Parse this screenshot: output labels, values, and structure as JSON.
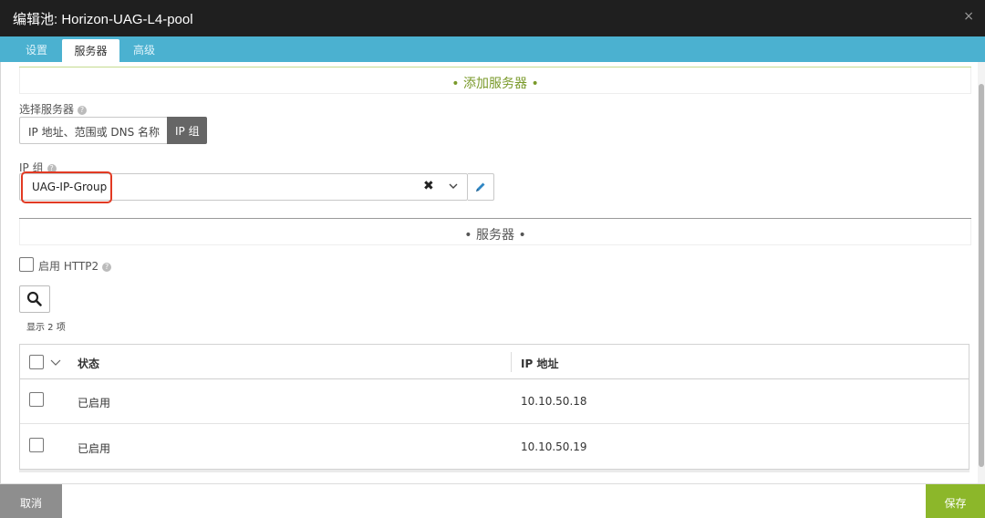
{
  "window": {
    "title": "编辑池: Horizon-UAG-L4-pool",
    "close_icon": "×"
  },
  "tabs": [
    {
      "label": "设置",
      "active": false
    },
    {
      "label": "服务器",
      "active": true
    },
    {
      "label": "高级",
      "active": false
    }
  ],
  "add_server": {
    "section_title": "• 添加服务器 •",
    "select_server_label": "选择服务器",
    "help_glyph": "?",
    "mode_ip_range_dns": "IP 地址、范围或 DNS 名称",
    "mode_ip_group": "IP 组",
    "ip_group_label": "IP 组",
    "ip_group_value": "UAG-IP-Group",
    "clear_glyph": "✖"
  },
  "servers": {
    "section_title": "• 服务器 •",
    "enable_http2_label": "启用 HTTP2",
    "count_text": "显示 2 项",
    "columns": {
      "status": "状态",
      "ip": "IP 地址"
    },
    "rows": [
      {
        "status": "已启用",
        "ip": "10.10.50.18"
      },
      {
        "status": "已启用",
        "ip": "10.10.50.19"
      }
    ]
  },
  "footer": {
    "cancel_label": "取消",
    "save_label": "保存"
  },
  "colors": {
    "titlebar": "#1f1f1f",
    "tabbar": "#4bb1d0",
    "section_title_green": "#7a9a2b",
    "save_button": "#8cb72a",
    "cancel_button": "#8e8e8e",
    "highlight_box": "#e23a23"
  },
  "icons": {
    "search": "search-icon",
    "edit": "pencil-icon",
    "dropdown": "chevron-down-icon",
    "clear": "clear-x-icon",
    "help": "help-circle-icon"
  }
}
